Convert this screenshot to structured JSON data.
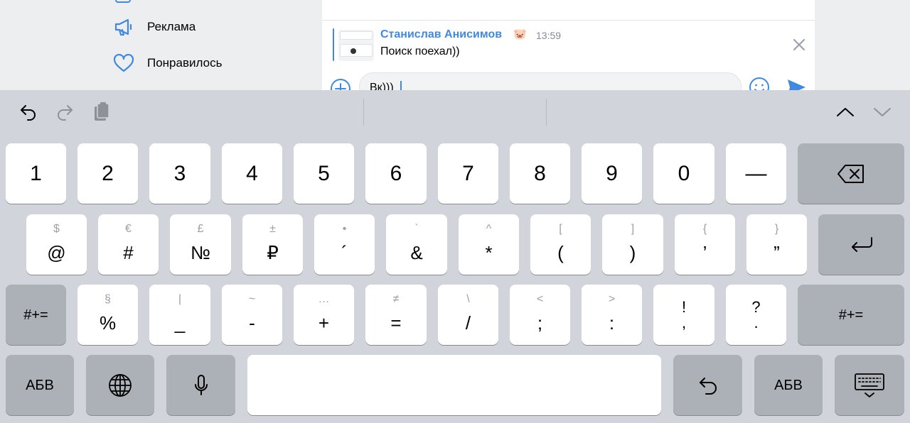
{
  "sidebar": {
    "items": [
      {
        "label": "Реклама",
        "icon": "megaphone-icon"
      },
      {
        "label": "Понравилось",
        "icon": "heart-icon"
      }
    ]
  },
  "chat": {
    "reply": {
      "author": "Станислав Анисимов",
      "emoji": "🐷",
      "time": "13:59",
      "text": "Поиск поехал))"
    },
    "composer": {
      "value": "Вк)))"
    }
  },
  "keyboard": {
    "toolbar": {
      "undo": "undo-icon",
      "redo": "redo-icon",
      "paste": "clipboard-icon",
      "up": "chevron-up-icon",
      "down": "chevron-down-icon"
    },
    "row1": [
      "1",
      "2",
      "3",
      "4",
      "5",
      "6",
      "7",
      "8",
      "9",
      "0",
      "—"
    ],
    "row2": [
      {
        "sub": "$",
        "main": "@"
      },
      {
        "sub": "€",
        "main": "#"
      },
      {
        "sub": "£",
        "main": "№"
      },
      {
        "sub": "±",
        "main": "₽"
      },
      {
        "sub": "•",
        "main": "´"
      },
      {
        "sub": "`",
        "main": "&"
      },
      {
        "sub": "^",
        "main": "*"
      },
      {
        "sub": "[",
        "main": "("
      },
      {
        "sub": "]",
        "main": ")"
      },
      {
        "sub": "{",
        "main": "’"
      },
      {
        "sub": "}",
        "main": "”"
      }
    ],
    "row3": [
      {
        "sub": "§",
        "main": "%"
      },
      {
        "sub": "|",
        "main": "_"
      },
      {
        "sub": "~",
        "main": "-"
      },
      {
        "sub": "…",
        "main": "+"
      },
      {
        "sub": "≠",
        "main": "="
      },
      {
        "sub": "\\",
        "main": "/"
      },
      {
        "sub": "<",
        "main": ";"
      },
      {
        "sub": ">",
        "main": ":"
      },
      {
        "top": "!",
        "bottom": ","
      },
      {
        "top": "?",
        "bottom": "."
      }
    ],
    "shift_label": "#+=",
    "abc_label": "АБВ",
    "colors": {
      "key": "#ffffff",
      "key_dark": "#acb0b7",
      "background": "#d1d5db",
      "accent": "#3f8ae0"
    }
  }
}
